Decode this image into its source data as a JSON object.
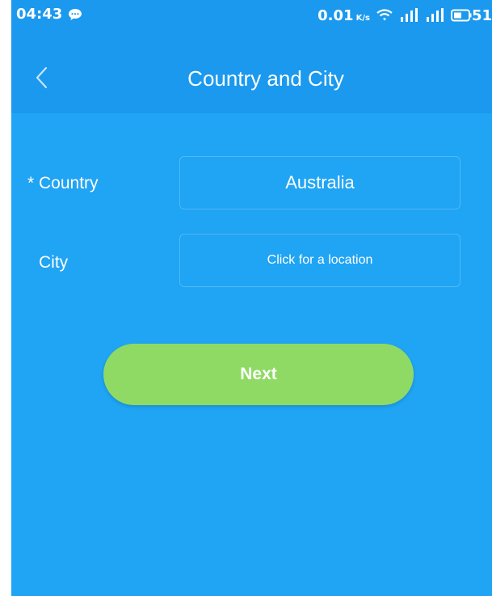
{
  "status_bar": {
    "time": "04:43",
    "net_speed": "0.01",
    "net_unit": "K/s",
    "battery": "51"
  },
  "header": {
    "title": "Country and City"
  },
  "form": {
    "country_label": "* Country",
    "country_value": "Australia",
    "city_label": "City",
    "city_placeholder": "Click for a location"
  },
  "actions": {
    "next_label": "Next"
  },
  "colors": {
    "background": "#20a4f4",
    "header": "#1a99ef",
    "next_button": "#8fda64"
  },
  "icons": [
    "chat-bubble-icon",
    "wifi-icon",
    "signal-icon",
    "battery-icon",
    "back-chevron-icon"
  ]
}
